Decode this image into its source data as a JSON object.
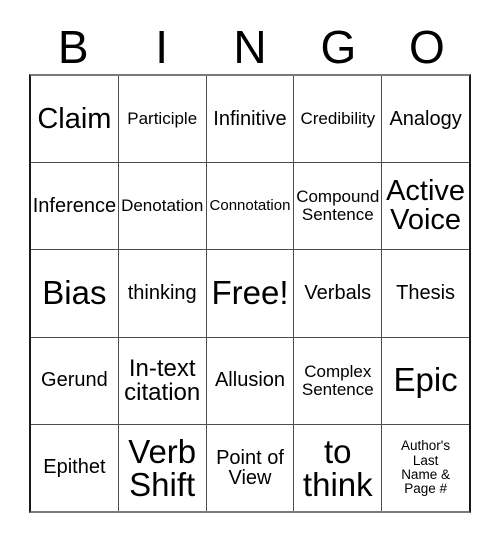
{
  "card": {
    "title": "BINGO",
    "header_letters": [
      "B",
      "I",
      "N",
      "G",
      "O"
    ],
    "colors": {
      "background": "#ffffff",
      "text": "#000000",
      "grid_line": "#4d4d4d",
      "outer_border": "#1a1a1a"
    },
    "grid": {
      "columns": 5,
      "rows": 5,
      "free_space_label": "Free!",
      "free_space_position": "center"
    },
    "cells": [
      [
        {
          "label": "Claim",
          "size": "xl"
        },
        {
          "label": "Participle",
          "size": "sm"
        },
        {
          "label": "Infinitive",
          "size": "md"
        },
        {
          "label": "Credibility",
          "size": "sm"
        },
        {
          "label": "Analogy",
          "size": "md"
        }
      ],
      [
        {
          "label": "Inference",
          "size": "md"
        },
        {
          "label": "Denotation",
          "size": "sm"
        },
        {
          "label": "Connotation",
          "size": "xs"
        },
        {
          "label": "Compound\nSentence",
          "size": "sm"
        },
        {
          "label": "Active\nVoice",
          "size": "xl"
        }
      ],
      [
        {
          "label": "Bias",
          "size": "xxl"
        },
        {
          "label": "thinking",
          "size": "md"
        },
        {
          "label": "Free!",
          "size": "xxl"
        },
        {
          "label": "Verbals",
          "size": "md"
        },
        {
          "label": "Thesis",
          "size": "md"
        }
      ],
      [
        {
          "label": "Gerund",
          "size": "md"
        },
        {
          "label": "In-text\ncitation",
          "size": "lg"
        },
        {
          "label": "Allusion",
          "size": "md"
        },
        {
          "label": "Complex\nSentence",
          "size": "sm"
        },
        {
          "label": "Epic",
          "size": "xxl"
        }
      ],
      [
        {
          "label": "Epithet",
          "size": "md"
        },
        {
          "label": "Verb\nShift",
          "size": "xxl"
        },
        {
          "label": "Point of\nView",
          "size": "md"
        },
        {
          "label": "to\nthink",
          "size": "xxl"
        },
        {
          "label": "Author's\nLast\nName &\nPage #",
          "size": "xxs"
        }
      ]
    ]
  }
}
